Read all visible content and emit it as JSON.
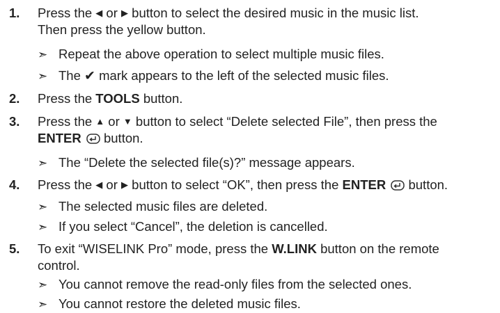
{
  "steps": [
    {
      "number": "1.",
      "line1_a": "Press the ",
      "icon_left": "◀",
      "line1_b": " or ",
      "icon_right": "▶",
      "line1_c": " button to select the desired music in the music list.",
      "line2": "Then press the yellow button.",
      "notes": [
        "Repeat the above operation to select multiple music files.",
        {
          "a": "The ",
          "icon": "✔",
          "b": " mark appears to the left of the selected music files."
        }
      ]
    },
    {
      "number": "2.",
      "a": "Press the ",
      "bold": "TOOLS",
      "b": " button."
    },
    {
      "number": "3.",
      "a": "Press the ",
      "icon_up": "▲",
      "b": " or ",
      "icon_down": "▼",
      "c": " button to select “Delete selected File”, then press the",
      "bold2": "ENTER",
      "d": " button.",
      "notes": [
        "The “Delete the selected file(s)?” message appears."
      ]
    },
    {
      "number": "4.",
      "a": "Press the ",
      "icon_left": "◀",
      "b": " or ",
      "icon_right": "▶",
      "c": " button to select “OK”, then press the ",
      "bold": "ENTER",
      "d": " button.",
      "notes": [
        "The selected music files are deleted.",
        "If you select “Cancel”, the deletion is cancelled."
      ]
    },
    {
      "number": "5.",
      "a": "To exit “WISELINK Pro” mode, press the ",
      "bold": "W.LINK",
      "b": " button on the remote",
      "line2": "control.",
      "notes": [
        "You cannot remove the read-only files from the selected ones.",
        "You cannot restore the deleted music files."
      ]
    }
  ],
  "note_marker": "➣",
  "icons": {
    "enter": "enter-icon",
    "note": "note-arrow-icon"
  }
}
